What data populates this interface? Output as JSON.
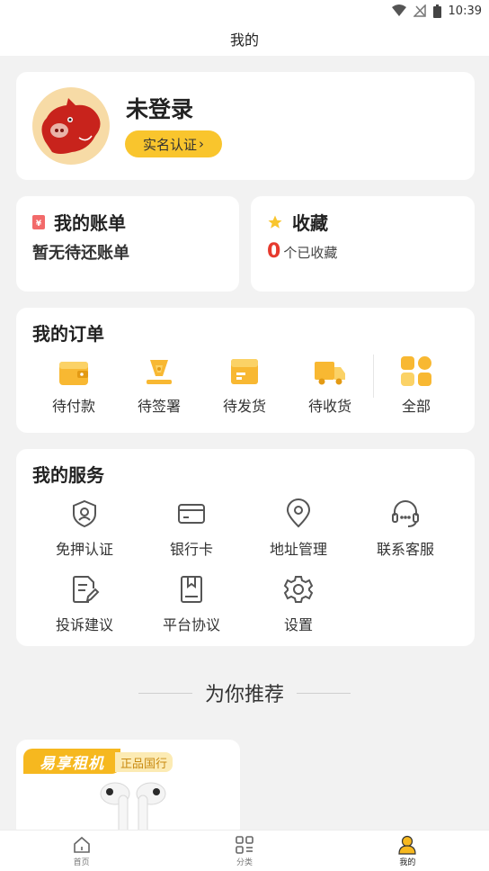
{
  "status_bar": {
    "time": "10:39"
  },
  "header": {
    "title": "我的"
  },
  "profile": {
    "name": "未登录",
    "verify_label": "实名认证",
    "verify_arrow": "›"
  },
  "bill": {
    "title": "我的账单",
    "subtitle": "暂无待还账单"
  },
  "favorites": {
    "title": "收藏",
    "count": "0",
    "suffix": "个已收藏"
  },
  "orders": {
    "title": "我的订单",
    "items": [
      {
        "label": "待付款",
        "icon": "wallet-icon"
      },
      {
        "label": "待签署",
        "icon": "pen-icon"
      },
      {
        "label": "待发货",
        "icon": "package-icon"
      },
      {
        "label": "待收货",
        "icon": "truck-icon"
      },
      {
        "label": "全部",
        "icon": "grid-icon"
      }
    ]
  },
  "services": {
    "title": "我的服务",
    "items": [
      {
        "label": "免押认证",
        "icon": "shield-user-icon"
      },
      {
        "label": "银行卡",
        "icon": "bank-card-icon"
      },
      {
        "label": "地址管理",
        "icon": "location-pin-icon"
      },
      {
        "label": "联系客服",
        "icon": "headset-icon"
      },
      {
        "label": "投诉建议",
        "icon": "document-edit-icon"
      },
      {
        "label": "平台协议",
        "icon": "bookmark-book-icon"
      },
      {
        "label": "设置",
        "icon": "gear-icon"
      }
    ]
  },
  "recommend": {
    "title": "为你推荐",
    "product": {
      "badge": "易享租机",
      "tag": "正品国行",
      "image": "earbuds-image"
    }
  },
  "tabbar": {
    "items": [
      {
        "label": "首页",
        "icon": "home-icon"
      },
      {
        "label": "分类",
        "icon": "category-icon"
      },
      {
        "label": "我的",
        "icon": "user-icon",
        "active": true
      }
    ]
  },
  "colors": {
    "accent": "#f9c52d",
    "count_red": "#e63a2e",
    "background": "#f2f2f2"
  }
}
